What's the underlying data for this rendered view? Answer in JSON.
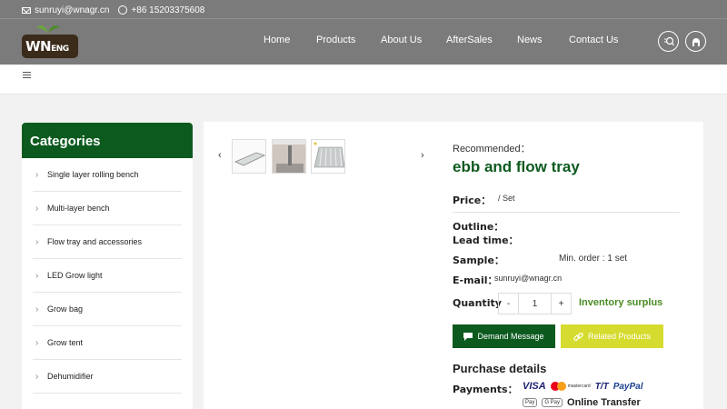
{
  "topbar": {
    "email": "sunruyi@wnagr.cn",
    "phone": "+86 15203375608"
  },
  "logo": {
    "text": "WN",
    "sub": "ENG"
  },
  "nav": [
    "Home",
    "Products",
    "About Us",
    "AfterSales",
    "News",
    "Contact Us"
  ],
  "sidebar": {
    "title": "Categories",
    "items": [
      "Single layer rolling bench",
      "Multi-layer bench",
      "Flow tray and accessories",
      "LED Grow light",
      "Grow bag",
      "Grow tent",
      "Dehumidifier"
    ]
  },
  "product": {
    "recommended": "Recommended：",
    "title": "ebb and flow tray",
    "price_label": "Price：",
    "price_value": "/ Set",
    "outline_label": "Outline：",
    "lead_label": "Lead time：",
    "sample_label": "Sample：",
    "min_order": "Min. order : 1 set",
    "email_label": "E-mail：",
    "email_value": "sunruyi@wnagr.cn",
    "quantity_label": "Quantity",
    "qty_minus": "-",
    "qty_value": "1",
    "qty_plus": "+",
    "inventory": "Inventory surplus",
    "demand_button": "Demand Message",
    "related_button": "Related Products",
    "purchase_title": "Purchase details",
    "payments_label": "Payments："
  },
  "payments": {
    "visa": "VISA",
    "mastercard": "mastercard",
    "tt": "T/T",
    "paypal": "PayPal",
    "applepay": "Pay",
    "gpay": "G Pay",
    "online": "Online Transfer"
  },
  "gallery": {
    "prev": "‹",
    "next": "›"
  },
  "colors": {
    "brand_green": "#0d5a1f",
    "accent_yellow": "#d6db2f",
    "header_gray": "#7b7b7b"
  }
}
